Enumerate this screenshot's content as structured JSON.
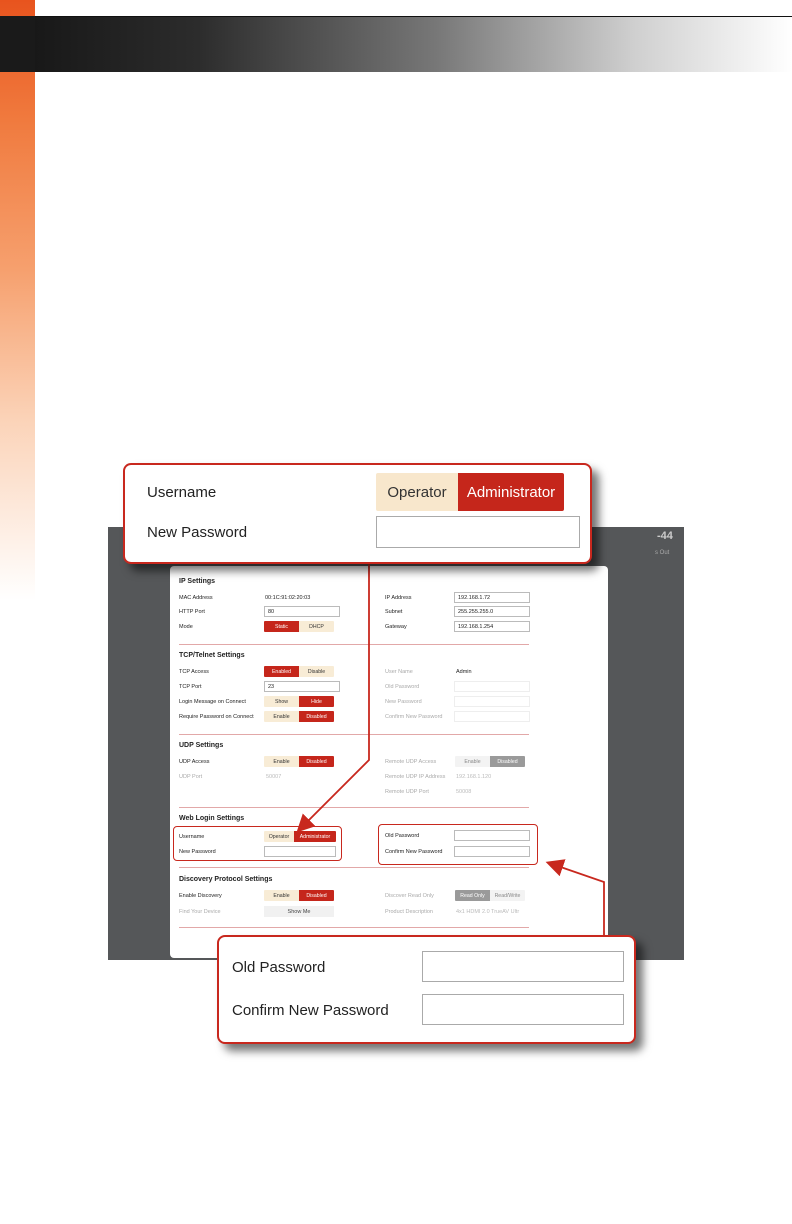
{
  "header": {
    "corner_title": "-44",
    "corner_sub": "s Out"
  },
  "ip": {
    "title": "IP Settings",
    "mac_label": "MAC Address",
    "mac_value": "00:1C:91:02:20:03",
    "http_label": "HTTP Port",
    "http_value": "80",
    "mode_label": "Mode",
    "mode_static": "Static",
    "mode_dhcp": "DHCP",
    "ip_label": "IP Address",
    "ip_value": "192.168.1.72",
    "subnet_label": "Subnet",
    "subnet_value": "255.255.255.0",
    "gateway_label": "Gateway",
    "gateway_value": "192.168.1.254"
  },
  "tcp": {
    "title": "TCP/Telnet Settings",
    "access_label": "TCP Access",
    "access_on": "Enabled",
    "access_off": "Disable",
    "port_label": "TCP Port",
    "port_value": "23",
    "login_msg_label": "Login Message on Connect",
    "show": "Show",
    "hide": "Hide",
    "req_pw_label": "Require Password on Connect",
    "enable": "Enable",
    "disabled": "Disabled",
    "user_label": "User Name",
    "user_value": "Admin",
    "old_pw_label": "Old Password",
    "new_pw_label": "New Password",
    "confirm_pw_label": "Confirm New Password"
  },
  "udp": {
    "title": "UDP Settings",
    "access_label": "UDP Access",
    "enable": "Enable",
    "disabled": "Disabled",
    "port_label": "UDP Port",
    "port_value": "50007",
    "remote_access_label": "Remote UDP Access",
    "remote_enable": "Enable",
    "remote_disabled": "Disabled",
    "remote_ip_label": "Remote UDP IP Address",
    "remote_ip_value": "192.168.1.120",
    "remote_port_label": "Remote UDP Port",
    "remote_port_value": "50008"
  },
  "web": {
    "title": "Web Login Settings",
    "username_label": "Username",
    "operator": "Operator",
    "administrator": "Administrator",
    "new_pw_label": "New Password",
    "old_pw_label": "Old Password",
    "confirm_pw_label": "Confirm New Password"
  },
  "discovery": {
    "title": "Discovery Protocol Settings",
    "enable_label": "Enable Discovery",
    "enable": "Enable",
    "disabled": "Disabled",
    "find_label": "Find Your Device",
    "show_me": "Show Me",
    "read_only_label": "Discover Read Only",
    "read_only": "Read Only",
    "read_write": "Read/Write",
    "product_label": "Product Description",
    "product_value": "4x1 HDMI 2.0 TrueAV Ultr"
  },
  "callout_top": {
    "username_label": "Username",
    "operator": "Operator",
    "administrator": "Administrator",
    "new_pw_label": "New Password"
  },
  "callout_bottom": {
    "old_pw_label": "Old Password",
    "confirm_pw_label": "Confirm New Password"
  },
  "colors": {
    "accent": "#c5261b",
    "toggle_off": "#f8ecd6",
    "screen_bg": "#555759"
  }
}
